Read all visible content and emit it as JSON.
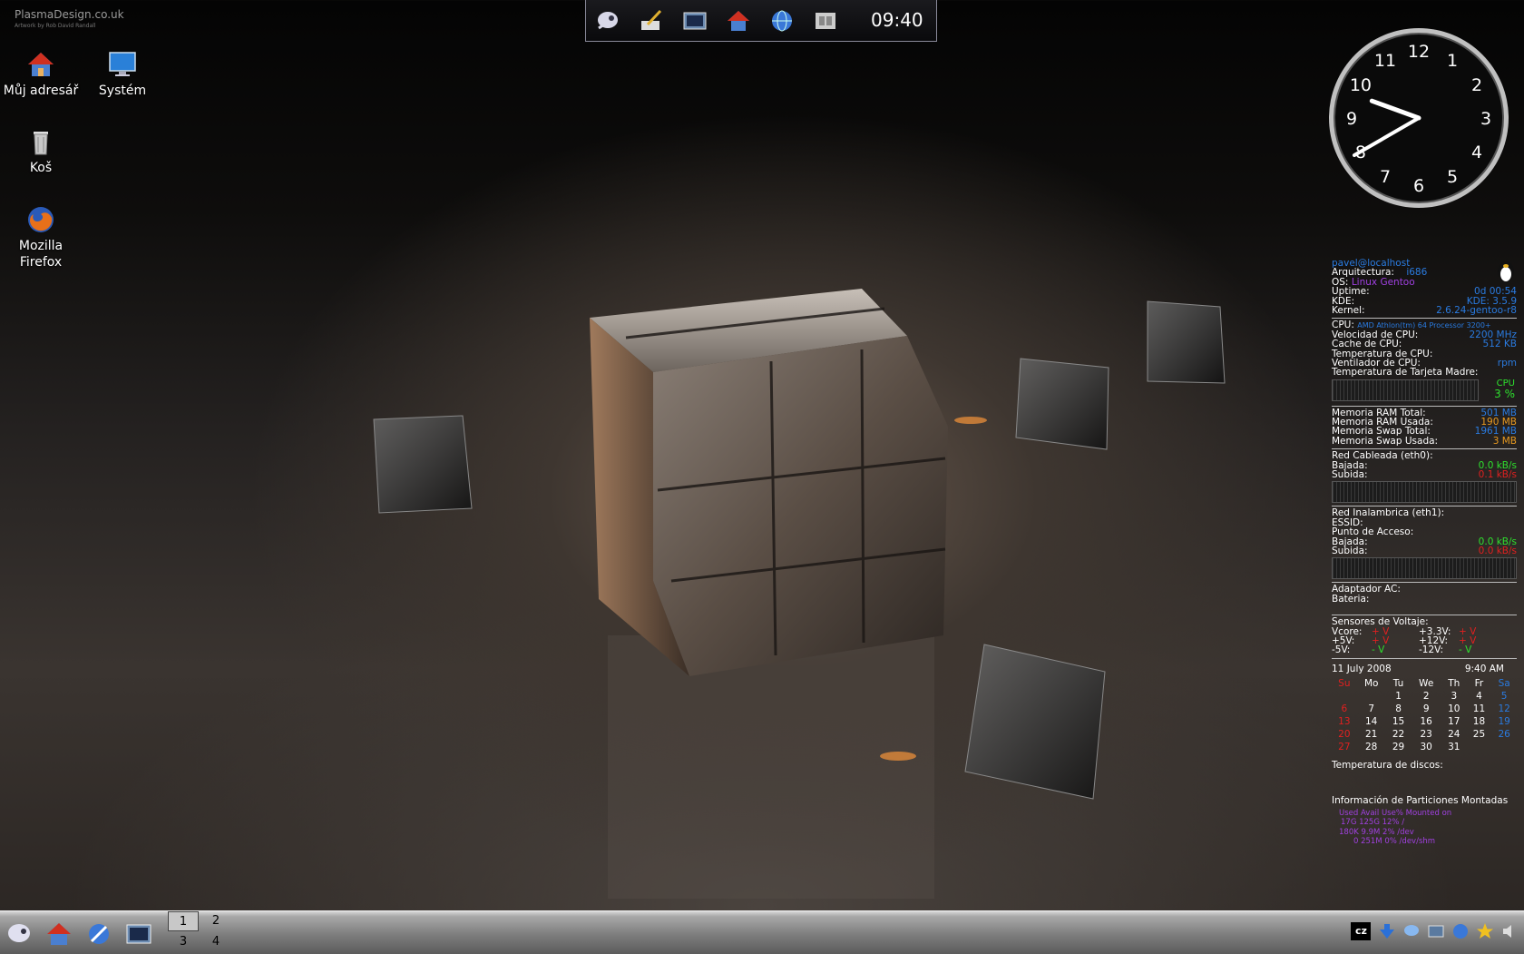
{
  "logo": {
    "line1": "PlasmaDesign.co.uk",
    "line2": "Artwork by Rob David Randall"
  },
  "desktop_icons": [
    {
      "label": "Můj adresář"
    },
    {
      "label": "Systém"
    },
    {
      "label": "Koš"
    },
    {
      "label": "Mozilla Firefox"
    }
  ],
  "top_panel": {
    "time": "09:40"
  },
  "analog_clock": {
    "numerals": [
      "12",
      "1",
      "2",
      "3",
      "4",
      "5",
      "6",
      "7",
      "8",
      "9",
      "10",
      "11"
    ],
    "hour": 9,
    "minute": 40
  },
  "sysinfo": {
    "user": "pavel@localhost",
    "arch_label": "Arquitectura:",
    "arch": "i686",
    "os_label": "OS:",
    "os": "Linux Gentoo",
    "uptime_label": "Uptime:",
    "uptime": "0d 00:54",
    "kde_label": "KDE:",
    "kde": "KDE: 3.5.9",
    "kernel_label": "Kernel:",
    "kernel": "2.6.24-gentoo-r8",
    "cpu_label": "CPU:",
    "cpu": "AMD Athlon(tm) 64 Processor 3200+",
    "cpu_speed_label": "Velocidad de CPU:",
    "cpu_speed": "2200 MHz",
    "cpu_cache_label": "Cache de CPU:",
    "cpu_cache": "512 KB",
    "cpu_temp_label": "Temperatura de CPU:",
    "cpu_fan_label": "Ventilador de CPU:",
    "cpu_fan": "rpm",
    "mb_temp_label": "Temperatura de Tarjeta Madre:",
    "cpu_graph_label": "CPU",
    "cpu_usage": "3 %",
    "ram_total_label": "Memoria RAM Total:",
    "ram_total": "501 MB",
    "ram_used_label": "Memoria RAM Usada:",
    "ram_used": "190 MB",
    "swap_total_label": "Memoria Swap Total:",
    "swap_total": "1961 MB",
    "swap_used_label": "Memoria Swap Usada:",
    "swap_used": "3 MB",
    "wired_label": "Red Cableada (eth0):",
    "wired_down_label": "Bajada:",
    "wired_down": "0.0 kB/s",
    "wired_up_label": "Subida:",
    "wired_up": "0.1 kB/s",
    "wifi_label": "Red Inalambrica (eth1):",
    "essid_label": "ESSID:",
    "ap_label": "Punto de Acceso:",
    "wifi_down_label": "Bajada:",
    "wifi_down": "0.0 kB/s",
    "wifi_up_label": "Subida:",
    "wifi_up": "0.0 kB/s",
    "ac_label": "Adaptador AC:",
    "battery_label": "Bateria:",
    "volt_label": "Sensores de Voltaje:",
    "vcore_label": "Vcore:",
    "vcore": "+ V",
    "v33_label": "+3.3V:",
    "v33": "+ V",
    "v5_label": "+5V:",
    "v5": "+ V",
    "v12_label": "+12V:",
    "v12": "+ V",
    "vm5_label": "-5V:",
    "vm5": "- V",
    "vm12_label": "-12V:",
    "vm12": "- V",
    "date": "11 July 2008",
    "time": "9:40 AM",
    "weekdays": [
      "Su",
      "Mo",
      "Tu",
      "We",
      "Th",
      "Fr",
      "Sa"
    ],
    "weeks": [
      [
        "",
        "",
        "1",
        "2",
        "3",
        "4",
        "5"
      ],
      [
        "6",
        "7",
        "8",
        "9",
        "10",
        "11",
        "12"
      ],
      [
        "13",
        "14",
        "15",
        "16",
        "17",
        "18",
        "19"
      ],
      [
        "20",
        "21",
        "22",
        "23",
        "24",
        "25",
        "26"
      ],
      [
        "27",
        "28",
        "29",
        "30",
        "31",
        "",
        ""
      ]
    ],
    "disk_temp_label": "Temperatura de discos:",
    "partitions_label": "Información de Particiones Montadas",
    "partitions_header": "Used Avail Use% Mounted on",
    "partitions": [
      "17G  125G  12% /",
      "180K  9.9M   2% /dev",
      "0  251M   0% /dev/shm"
    ]
  },
  "pager": {
    "desktops": [
      "1",
      "2",
      "3",
      "4"
    ],
    "active": "1"
  },
  "tray": {
    "keyboard_layout": "cz"
  },
  "colors": {
    "accent_blue": "#2a7be0",
    "purple": "#a040e0",
    "orange": "#e89a20",
    "green": "#2ee02e",
    "red": "#e02020"
  }
}
